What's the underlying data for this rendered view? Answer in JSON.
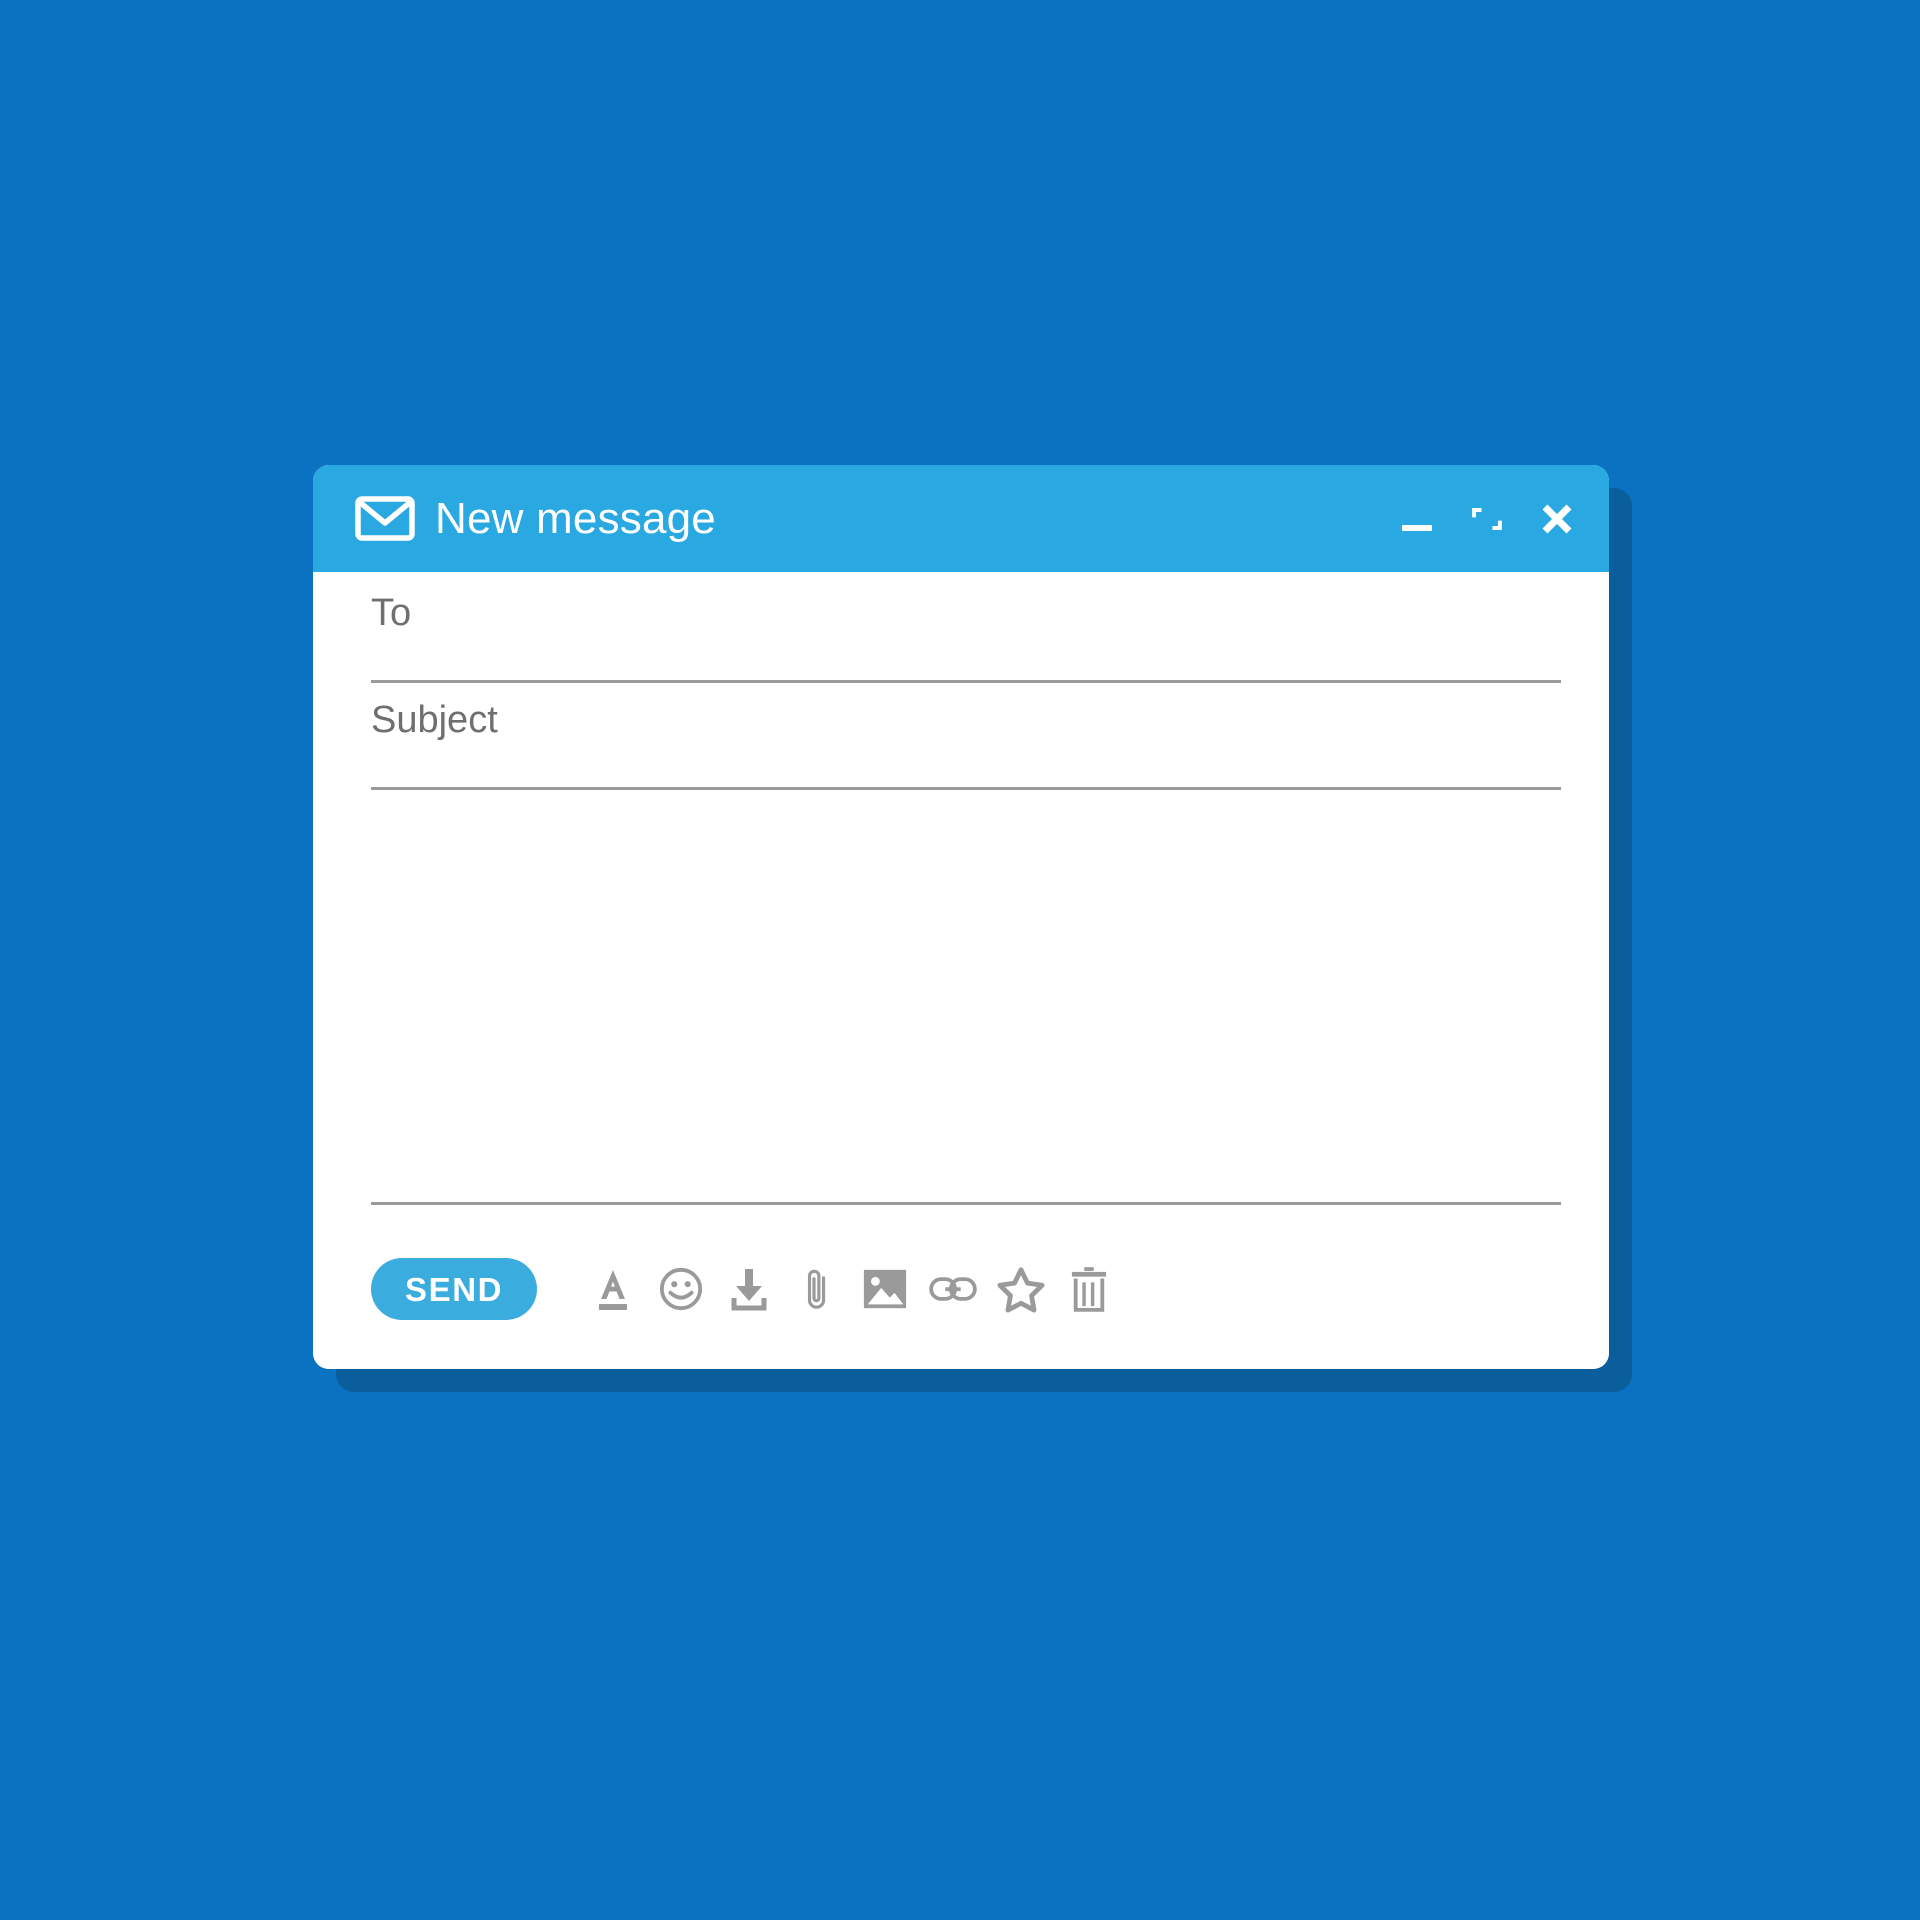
{
  "theme": {
    "page_background": "#0a72c0",
    "shadow_color": "#0b5e9c",
    "titlebar_color": "#29a8e1",
    "window_background": "#ffffff",
    "send_button_color": "#3aadde",
    "icon_color": "#9a9a9a",
    "placeholder_color": "#6f6f6f",
    "divider_color": "#9a9a9a"
  },
  "window": {
    "title": "New message",
    "title_icon": "envelope-icon",
    "controls": [
      {
        "name": "minimize-button",
        "icon": "minimize-icon",
        "label": "Minimize"
      },
      {
        "name": "maximize-button",
        "icon": "maximize-icon",
        "label": "Maximize"
      },
      {
        "name": "close-button",
        "icon": "close-icon",
        "label": "Close"
      }
    ]
  },
  "compose": {
    "to": {
      "label": "To",
      "placeholder": "To",
      "value": ""
    },
    "subject": {
      "label": "Subject",
      "placeholder": "Subject",
      "value": ""
    },
    "message": {
      "placeholder": "",
      "value": ""
    }
  },
  "toolbar": {
    "send_label": "SEND",
    "icons": [
      {
        "name": "format-text-icon",
        "label": "Formatting options"
      },
      {
        "name": "emoji-icon",
        "label": "Insert emoji"
      },
      {
        "name": "download-icon",
        "label": "Save draft"
      },
      {
        "name": "attachment-icon",
        "label": "Attach file"
      },
      {
        "name": "image-icon",
        "label": "Insert photo"
      },
      {
        "name": "link-icon",
        "label": "Insert link"
      },
      {
        "name": "star-icon",
        "label": "Mark important"
      },
      {
        "name": "trash-icon",
        "label": "Discard draft"
      }
    ]
  }
}
